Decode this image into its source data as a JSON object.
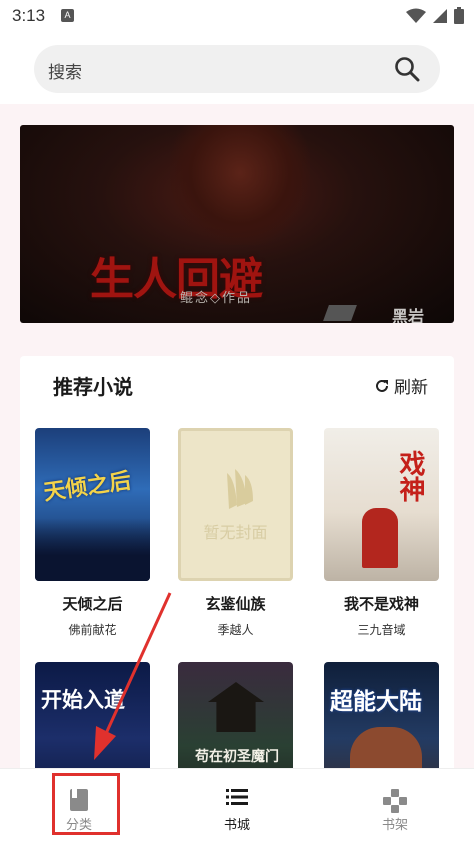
{
  "status_bar": {
    "time": "3:13",
    "notification_badge": "A",
    "icons": [
      "wifi-icon",
      "signal-icon",
      "battery-icon"
    ]
  },
  "search": {
    "placeholder": "搜索"
  },
  "banner": {
    "title": "生人回避",
    "subtitle": "鲲念◇作品",
    "publisher": "黑岩"
  },
  "recommend": {
    "title": "推荐小说",
    "refresh_label": "刷新",
    "books": [
      {
        "title": "天倾之后",
        "author": "佛前献花",
        "cover_text": "天倾之后"
      },
      {
        "title": "玄鉴仙族",
        "author": "季越人",
        "cover_text": "暂无封面"
      },
      {
        "title": "我不是戏神",
        "author": "三九音域",
        "cover_text": "戏神"
      },
      {
        "title": "",
        "author": "",
        "cover_text": "开始入道"
      },
      {
        "title": "",
        "author": "",
        "cover_text": "苟在初圣魔门"
      },
      {
        "title": "",
        "author": "",
        "cover_text": "超能大陆"
      }
    ]
  },
  "bottom_nav": {
    "items": [
      {
        "label": "分类",
        "icon": "book-icon",
        "active": false
      },
      {
        "label": "书城",
        "icon": "list-icon",
        "active": true
      },
      {
        "label": "书架",
        "icon": "gamepad-icon",
        "active": false
      }
    ]
  },
  "colors": {
    "annotation_red": "#e0312d",
    "page_bg": "#fcf3f5"
  }
}
